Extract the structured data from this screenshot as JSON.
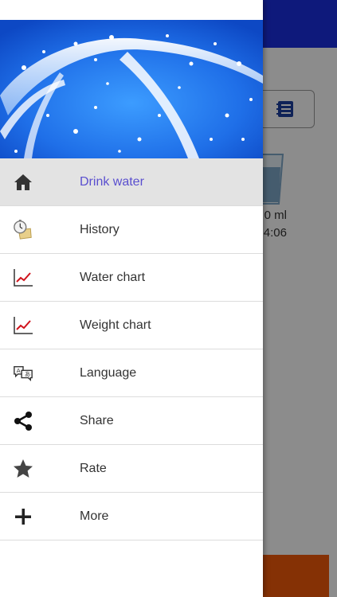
{
  "background_app": {
    "amount_label": "0 ml",
    "time_label": "4:06",
    "colors": {
      "topbar": "#1a2fe0",
      "bottom_button": "#f25a0a",
      "glass": "#7fa8c9"
    }
  },
  "drawer": {
    "header_image": "water-splash-banner",
    "colors": {
      "active_row": "#e3e3e3",
      "active_text": "#5a4fcf",
      "text": "#333333",
      "chart_line": "#d0121b"
    },
    "items": [
      {
        "label": "Drink water",
        "icon": "home-icon",
        "active": true
      },
      {
        "label": "History",
        "icon": "stopwatch-scroll-icon",
        "active": false
      },
      {
        "label": "Water chart",
        "icon": "line-chart-icon",
        "active": false
      },
      {
        "label": "Weight chart",
        "icon": "line-chart-icon",
        "active": false
      },
      {
        "label": "Language",
        "icon": "translate-icon",
        "active": false
      },
      {
        "label": "Share",
        "icon": "share-icon",
        "active": false
      },
      {
        "label": "Rate",
        "icon": "star-icon",
        "active": false
      },
      {
        "label": "More",
        "icon": "plus-icon",
        "active": false
      }
    ]
  }
}
